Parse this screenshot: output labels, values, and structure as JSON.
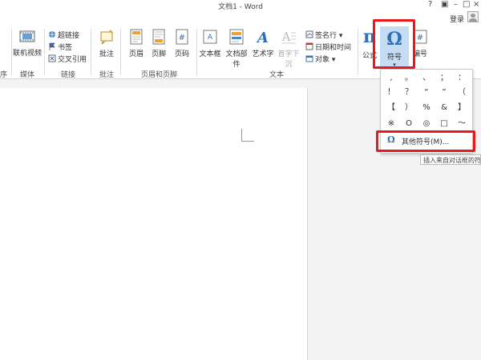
{
  "window": {
    "title": "文档1 - Word",
    "controls": {
      "help": "?",
      "minimize": "–",
      "restore": "□",
      "close": "×"
    },
    "login": "登录"
  },
  "ribbon": {
    "cut_group_tail": "序",
    "media": {
      "online_video": "联机视频",
      "group": "媒体"
    },
    "links": {
      "hyperlink": "超链接",
      "bookmark": "书签",
      "cross_ref": "交叉引用",
      "group": "链接"
    },
    "comments": {
      "comment": "批注",
      "group": "批注"
    },
    "header_footer": {
      "header": "页眉",
      "footer": "页脚",
      "page_number": "页码",
      "group": "页眉和页脚"
    },
    "text": {
      "textbox": "文本框",
      "quick_parts": "文档部件",
      "wordart": "艺术字",
      "dropcap": "首字下沉",
      "signature": "签名行",
      "datetime": "日期和时间",
      "object": "对象",
      "group": "文本"
    },
    "symbols": {
      "equation": "公式",
      "symbol": "符号",
      "number": "编号"
    }
  },
  "symbol_dropdown": {
    "symbols": [
      ",",
      "。",
      "、",
      "；",
      "：",
      "！",
      "？",
      "“",
      "”",
      "（",
      "【",
      "）",
      "%",
      "&",
      "】",
      "※",
      "O",
      "◎",
      "□",
      "～"
    ],
    "more_symbols": "其他符号(M)...",
    "tooltip": "插入来自对话框的符号"
  },
  "colors": {
    "highlight": "#e8181b",
    "accent": "#2f6fb6"
  }
}
